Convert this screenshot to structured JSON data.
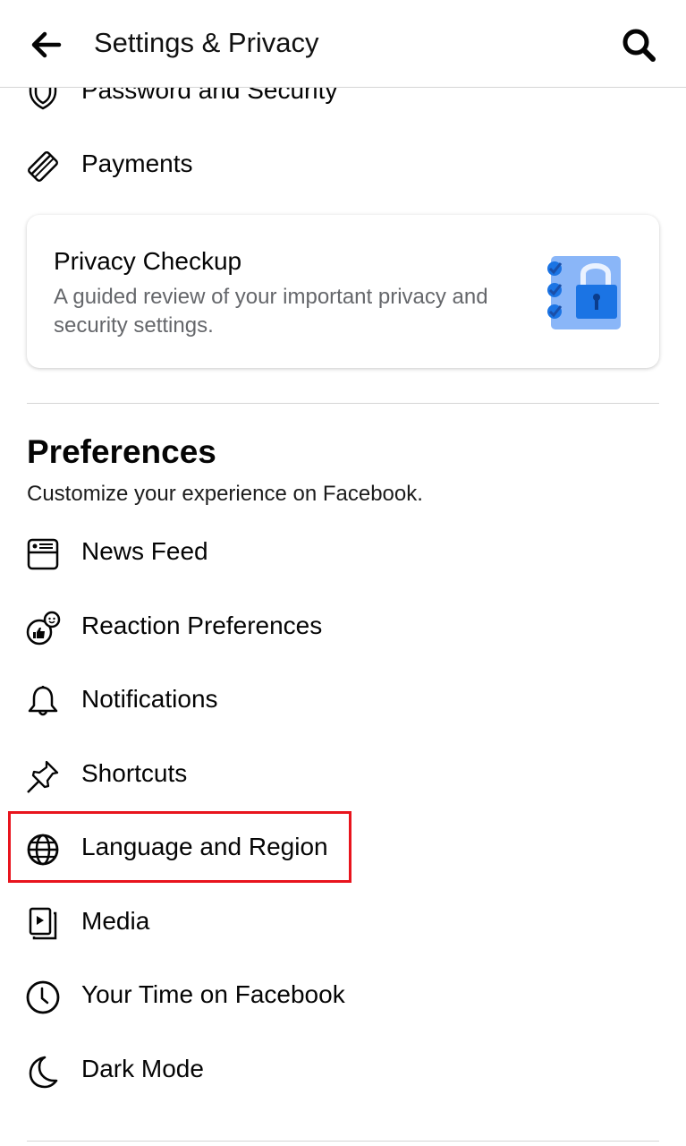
{
  "header": {
    "title": "Settings & Privacy",
    "back_icon": "arrow-left-icon",
    "search_icon": "search-icon"
  },
  "top_items": [
    {
      "label": "Password and Security",
      "icon": "shield-icon"
    },
    {
      "label": "Payments",
      "icon": "credit-card-icon"
    }
  ],
  "privacy_checkup": {
    "title": "Privacy Checkup",
    "description": "A guided review of your important privacy and security settings.",
    "icon": "checklist-lock-icon",
    "colors": {
      "light": "#8ab6f8",
      "dark": "#1b74e4"
    }
  },
  "preferences": {
    "title": "Preferences",
    "subtitle": "Customize your experience on Facebook.",
    "items": [
      {
        "label": "News Feed",
        "icon": "news-feed-icon"
      },
      {
        "label": "Reaction Preferences",
        "icon": "reaction-icon"
      },
      {
        "label": "Notifications",
        "icon": "bell-icon"
      },
      {
        "label": "Shortcuts",
        "icon": "pin-icon"
      },
      {
        "label": "Language and Region",
        "icon": "globe-icon",
        "highlighted": true
      },
      {
        "label": "Media",
        "icon": "media-icon"
      },
      {
        "label": "Your Time on Facebook",
        "icon": "clock-icon"
      },
      {
        "label": "Dark Mode",
        "icon": "moon-icon"
      }
    ]
  },
  "highlight_color": "#e8141d"
}
